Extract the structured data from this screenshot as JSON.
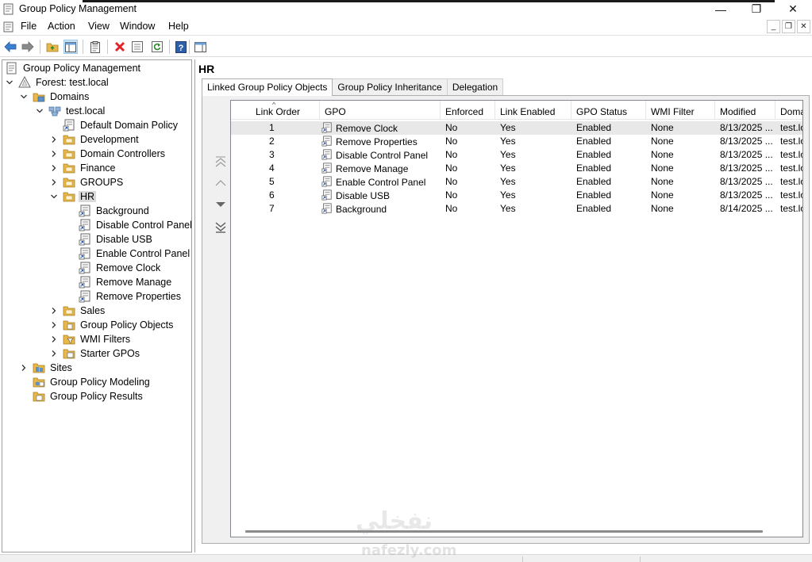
{
  "window": {
    "title": "Group Policy Management",
    "minimize_glyph": "—",
    "maximize_glyph": "❐",
    "close_glyph": "✕"
  },
  "menu": {
    "items": [
      "File",
      "Action",
      "View",
      "Window",
      "Help"
    ],
    "mdi_minimize": "_",
    "mdi_restore": "❐",
    "mdi_close": "✕"
  },
  "toolbar": {
    "buttons": [
      "back-icon",
      "forward-icon",
      "up-folder-icon",
      "show-hide-tree-icon",
      "properties-icon",
      "delete-icon",
      "export-list-icon",
      "refresh-icon",
      "help-icon",
      "show-action-pane-icon"
    ]
  },
  "tree": {
    "root": "Group Policy Management",
    "forest": "Forest: test.local",
    "domains": "Domains",
    "domain": "test.local",
    "default_policy": "Default Domain Policy",
    "ous": {
      "development": "Development",
      "domain_controllers": "Domain Controllers",
      "finance": "Finance",
      "groups": "GROUPS",
      "hr": "HR"
    },
    "hr_links": [
      "Background",
      "Disable Control Panel",
      "Disable USB",
      "Enable Control Panel",
      "Remove Clock",
      "Remove Manage",
      "Remove Properties"
    ],
    "sales": "Sales",
    "gpo_container": "Group Policy Objects",
    "wmi_filters": "WMI Filters",
    "starter_gpos": "Starter GPOs",
    "sites": "Sites",
    "modeling": "Group Policy Modeling",
    "results": "Group Policy Results"
  },
  "content": {
    "heading": "HR",
    "tabs": [
      "Linked Group Policy Objects",
      "Group Policy Inheritance",
      "Delegation"
    ],
    "active_tab": "Linked Group Policy Objects",
    "columns": [
      "Link Order",
      "GPO",
      "Enforced",
      "Link Enabled",
      "GPO Status",
      "WMI Filter",
      "Modified",
      "Doma"
    ],
    "sort_glyph": "^",
    "rows": [
      [
        "1",
        "Remove Clock",
        "No",
        "Yes",
        "Enabled",
        "None",
        "8/13/2025 ...",
        "test.lo"
      ],
      [
        "2",
        "Remove Properties",
        "No",
        "Yes",
        "Enabled",
        "None",
        "8/13/2025 ...",
        "test.lo"
      ],
      [
        "3",
        "Disable Control Panel",
        "No",
        "Yes",
        "Enabled",
        "None",
        "8/13/2025 ...",
        "test.lo"
      ],
      [
        "4",
        "Remove Manage",
        "No",
        "Yes",
        "Enabled",
        "None",
        "8/13/2025 ...",
        "test.lo"
      ],
      [
        "5",
        "Enable Control Panel",
        "No",
        "Yes",
        "Enabled",
        "None",
        "8/13/2025 ...",
        "test.lo"
      ],
      [
        "6",
        "Disable USB",
        "No",
        "Yes",
        "Enabled",
        "None",
        "8/13/2025 ...",
        "test.lo"
      ],
      [
        "7",
        "Background",
        "No",
        "Yes",
        "Enabled",
        "None",
        "8/14/2025 ...",
        "test.lo"
      ]
    ],
    "order_buttons": [
      "move-to-top-icon",
      "move-up-icon",
      "move-down-icon",
      "move-to-bottom-icon"
    ]
  },
  "watermark": {
    "arabic": "نفخلي",
    "latin": "nafezly.com"
  },
  "colors": {
    "selection": "#d9d9d9",
    "folder": "#e8b84a",
    "delete": "#e0242a",
    "back_arrow": "#3c7fd1"
  }
}
